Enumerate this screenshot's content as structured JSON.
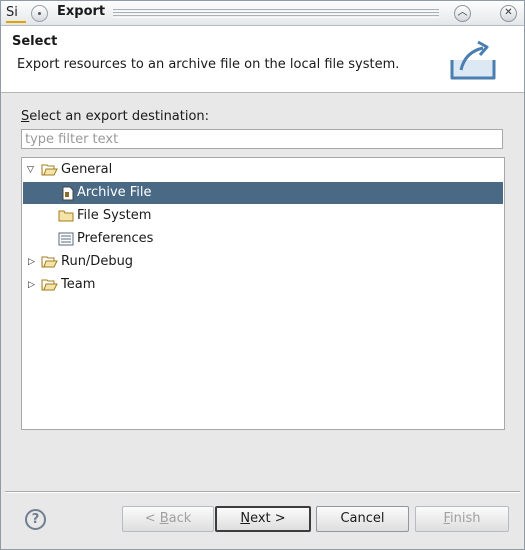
{
  "window": {
    "app_icon_text": "Si",
    "title": "Export",
    "minimize_icon": "chevron-up-icon",
    "close_icon": "close-icon"
  },
  "header": {
    "title": "Select",
    "description": "Export resources to an archive file on the local file system.",
    "icon": "export-icon"
  },
  "destination": {
    "label_mnemonic": "S",
    "label_rest": "elect an export destination:",
    "filter_placeholder": "type filter text"
  },
  "tree": {
    "items": [
      {
        "label": "General",
        "icon": "folder-open-icon",
        "expanded": true,
        "level": 0
      },
      {
        "label": "Archive File",
        "icon": "archive-file-icon",
        "selected": true,
        "level": 1
      },
      {
        "label": "File System",
        "icon": "folder-icon",
        "level": 1
      },
      {
        "label": "Preferences",
        "icon": "preferences-icon",
        "level": 1
      },
      {
        "label": "Run/Debug",
        "icon": "folder-open-icon",
        "expanded": false,
        "level": 0
      },
      {
        "label": "Team",
        "icon": "folder-open-icon",
        "expanded": false,
        "level": 0
      }
    ]
  },
  "buttons": {
    "help_text": "?",
    "back_prefix": "< ",
    "back_mnemonic": "B",
    "back_rest": "ack",
    "next_mnemonic": "N",
    "next_rest": "ext >",
    "cancel": "Cancel",
    "finish_mnemonic": "F",
    "finish_rest": "inish"
  }
}
